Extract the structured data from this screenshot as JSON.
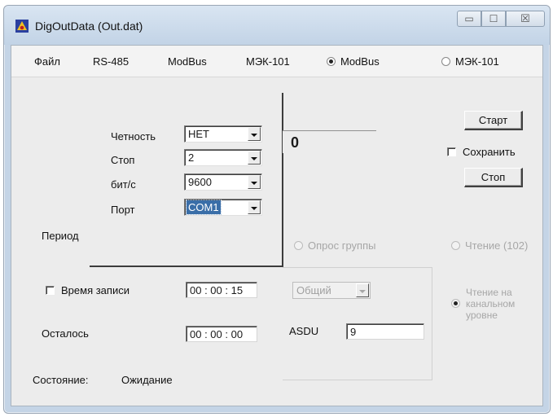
{
  "window": {
    "title": "DigOutData (Out.dat)",
    "controls": {
      "minimize": "▭",
      "maximize": "☐",
      "close": "☒"
    }
  },
  "menu": {
    "file": "Файл",
    "rs485": "RS-485",
    "modbus": "ModBus",
    "mek101": "МЭК-101",
    "radio_modbus": "ModBus",
    "radio_mek101": "МЭК-101",
    "selected_protocol": "ModBus"
  },
  "port_settings": {
    "parity_label": "Четность",
    "parity_value": "НЕТ",
    "stop_label": "Стоп",
    "stop_value": "2",
    "baud_label": "бит/с",
    "baud_value": "9600",
    "port_label": "Порт",
    "port_value": "COM1"
  },
  "main": {
    "period_label": "Период",
    "counter_value": "0",
    "start_button": "Старт",
    "save_label": "Сохранить",
    "save_checked": false,
    "stop_button": "Стоп",
    "poll_group_label": "Опрос группы",
    "read_102_label": "Чтение (102)",
    "read_channel_label": "Чтение на канальном уровне",
    "record_time_label": "Время записи",
    "record_time_checked": false,
    "record_time_value": "00 : 00 : 15",
    "group_select_value": "Общий",
    "remaining_label": "Осталось",
    "remaining_value": "00 : 00 : 00",
    "asdu_label": "ASDU",
    "asdu_value": "9",
    "status_label": "Состояние:",
    "status_value": "Ожидание"
  },
  "colors": {
    "title_bar": "#c8d8ea",
    "dialog_bg": "#ececec",
    "selection": "#3a6ea8",
    "disabled_text": "#a7a7a7"
  },
  "icons": {
    "app": "app-icon",
    "dropdown": "chevron-down-icon"
  }
}
